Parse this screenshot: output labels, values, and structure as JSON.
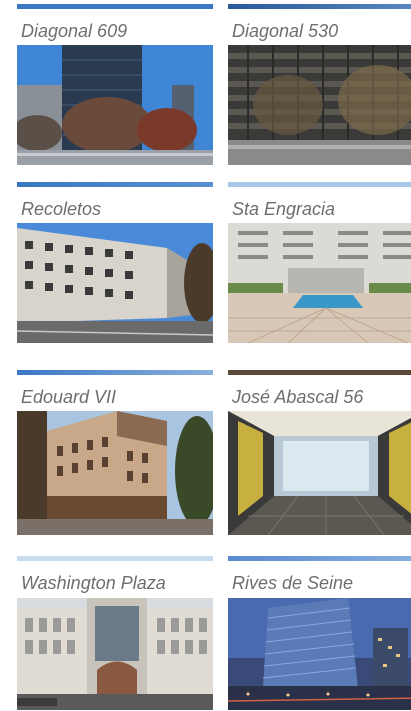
{
  "properties": [
    {
      "name": "Diagonal 609",
      "photo": "office-tower-photo",
      "accent": "#3a78c4"
    },
    {
      "name": "Diagonal 530",
      "photo": "office-facade-photo",
      "accent": "#3a78c4"
    },
    {
      "name": "Recoletos",
      "photo": "residential-block-photo",
      "accent": "#3a78c4"
    },
    {
      "name": "Sta Engracia",
      "photo": "office-courtyard-photo",
      "accent": "#a8c8ea"
    },
    {
      "name": "Edouard VII",
      "photo": "haussmann-building-photo",
      "accent": "#3a78c4"
    },
    {
      "name": "José Abascal 56",
      "photo": "office-interior-photo",
      "accent": "#5a4a3a"
    },
    {
      "name": "Washington Plaza",
      "photo": "art-deco-building-photo",
      "accent": "#c8dcf0"
    },
    {
      "name": "Rives de Seine",
      "photo": "glass-tower-dusk-photo",
      "accent": "#6a98d8"
    }
  ]
}
